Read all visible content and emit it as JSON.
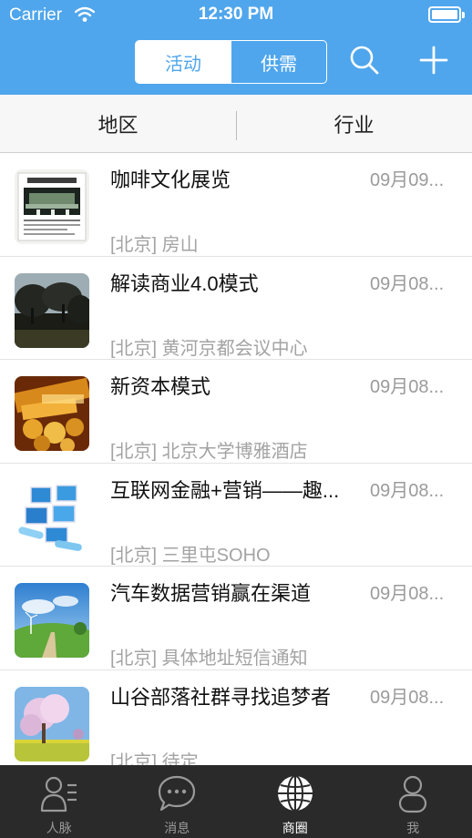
{
  "status_bar": {
    "carrier": "Carrier",
    "time": "12:30 PM"
  },
  "nav": {
    "segments": [
      "活动",
      "供需"
    ],
    "active_segment": 0,
    "colors": {
      "bar": "#4fa6ec",
      "active_text": "#4fa6ec"
    }
  },
  "filters": {
    "region": "地区",
    "industry": "行业"
  },
  "items": [
    {
      "title": "咖啡文化展览",
      "date": "09月09...",
      "location": "[北京] 房山",
      "thumb": "exhibit-poster"
    },
    {
      "title": "解读商业4.0模式",
      "date": "09月08...",
      "location": "[北京] 黄河京都会议中心",
      "thumb": "dark-trees"
    },
    {
      "title": "新资本模式",
      "date": "09月08...",
      "location": "[北京] 北京大学博雅酒店",
      "thumb": "gold-coins"
    },
    {
      "title": "互联网金融+营销——趣...",
      "date": "09月08...",
      "location": "[北京] 三里屯SOHO",
      "thumb": "network-screens"
    },
    {
      "title": "汽车数据营销赢在渠道",
      "date": "09月08...",
      "location": "[北京] 具体地址短信通知",
      "thumb": "windmill-field"
    },
    {
      "title": "山谷部落社群寻找追梦者",
      "date": "09月08...",
      "location": "[北京] 待定",
      "thumb": "blossom-tree"
    }
  ],
  "tabbar": {
    "tabs": [
      {
        "label": "人脉",
        "icon": "contacts-icon"
      },
      {
        "label": "消息",
        "icon": "chat-bubble-icon"
      },
      {
        "label": "商圈",
        "icon": "globe-icon"
      },
      {
        "label": "我",
        "icon": "person-icon"
      }
    ],
    "active_tab": 2
  }
}
